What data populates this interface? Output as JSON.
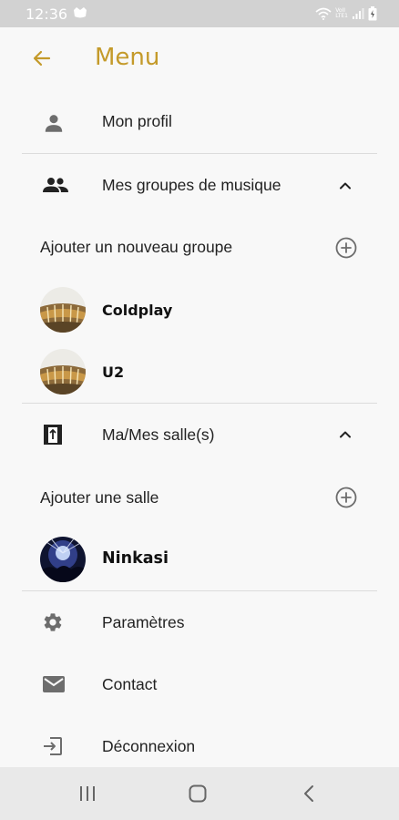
{
  "status_bar": {
    "time": "12:36",
    "volte_top": "VoII",
    "volte_bottom": "LTE1"
  },
  "header": {
    "title": "Menu",
    "back_icon": "arrow-left-icon"
  },
  "menu": {
    "profile": {
      "label": "Mon profil",
      "icon": "person-icon"
    },
    "bands": {
      "label": "Mes groupes de musique",
      "icon": "group-icon",
      "add_label": "Ajouter un nouveau groupe",
      "items": [
        {
          "name": "Coldplay"
        },
        {
          "name": "U2"
        }
      ]
    },
    "venues": {
      "label": "Ma/Mes salle(s)",
      "icon": "venue-door-icon",
      "add_label": "Ajouter une salle",
      "items": [
        {
          "name": "Ninkasi"
        }
      ]
    },
    "settings": {
      "label": "Paramètres",
      "icon": "gear-icon"
    },
    "contact": {
      "label": "Contact",
      "icon": "mail-icon"
    },
    "logout": {
      "label": "Déconnexion",
      "icon": "logout-icon"
    }
  },
  "colors": {
    "accent": "#c49a2a",
    "background": "#f8f8f8",
    "icon_gray": "#6d6d6d",
    "status_bar": "#d2d2d2",
    "nav_bar": "#e9e9e9"
  }
}
